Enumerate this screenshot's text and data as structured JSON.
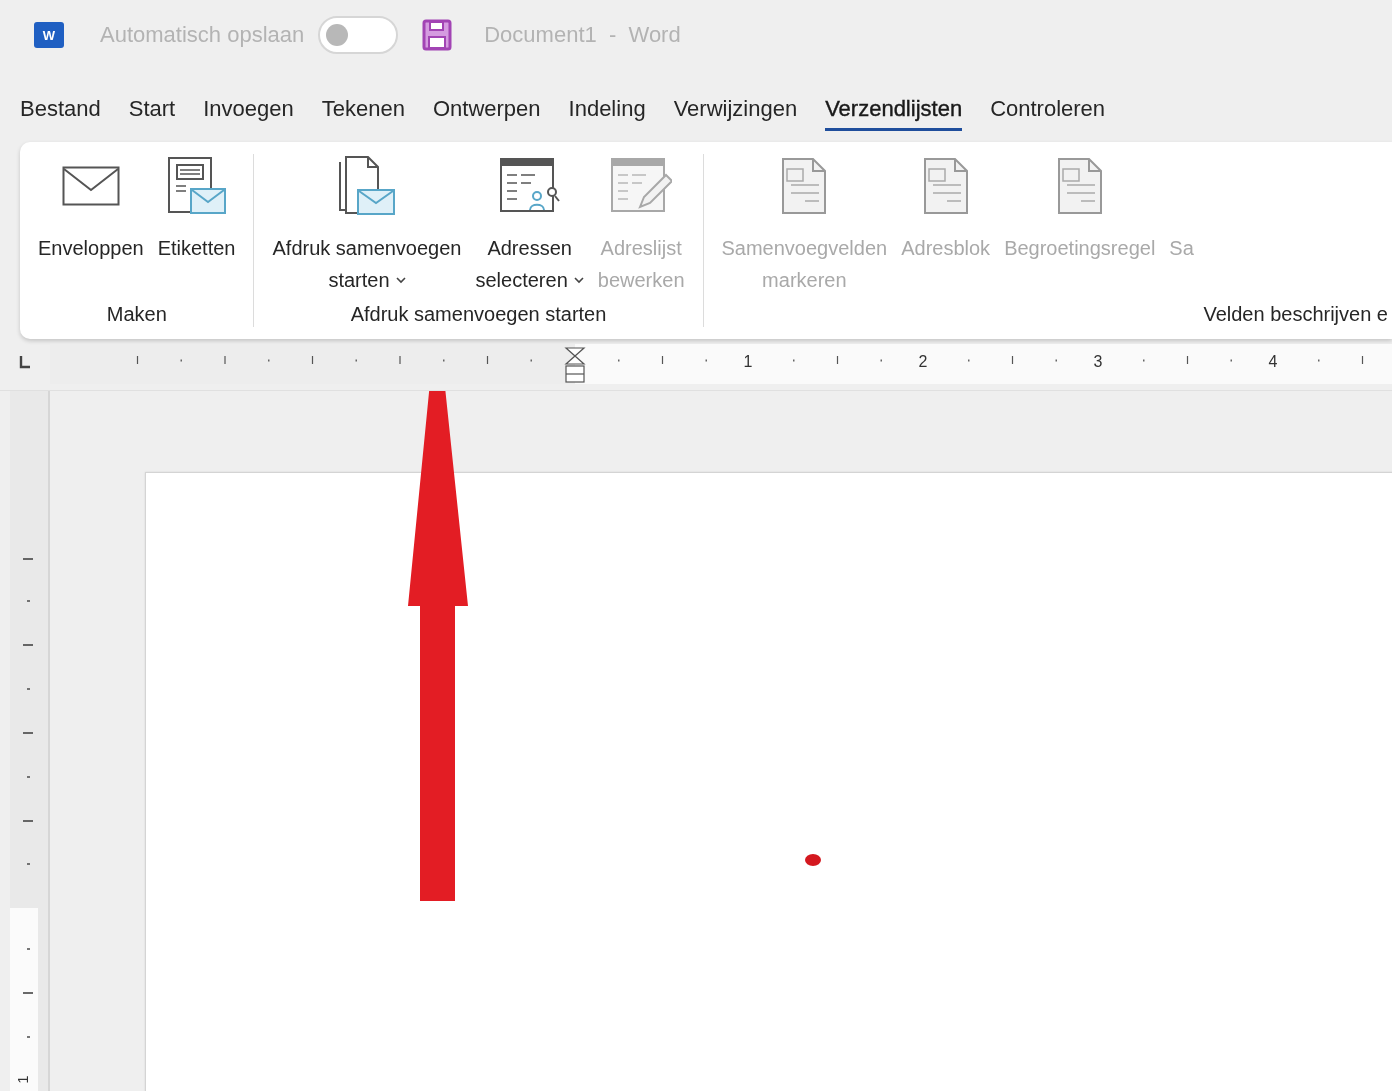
{
  "title_bar": {
    "app_icon_letter": "W",
    "autosave_label": "Automatisch opslaan",
    "autosave_on": false,
    "document_title": "Document1  -  Word"
  },
  "tabs": [
    {
      "label": "Bestand",
      "selected": false
    },
    {
      "label": "Start",
      "selected": false
    },
    {
      "label": "Invoegen",
      "selected": false
    },
    {
      "label": "Tekenen",
      "selected": false
    },
    {
      "label": "Ontwerpen",
      "selected": false
    },
    {
      "label": "Indeling",
      "selected": false
    },
    {
      "label": "Verwijzingen",
      "selected": false
    },
    {
      "label": "Verzendlijsten",
      "selected": true
    },
    {
      "label": "Controleren",
      "selected": false
    }
  ],
  "ribbon": {
    "groups": [
      {
        "label": "Maken",
        "buttons": [
          {
            "kind": "envelope",
            "lines": [
              "Enveloppen"
            ],
            "disabled": false,
            "dropdown": false
          },
          {
            "kind": "labels",
            "lines": [
              "Etiketten"
            ],
            "disabled": false,
            "dropdown": false
          }
        ]
      },
      {
        "label": "Afdruk samenvoegen starten",
        "buttons": [
          {
            "kind": "merge",
            "lines": [
              "Afdruk samenvoegen",
              "starten"
            ],
            "disabled": false,
            "dropdown": true
          },
          {
            "kind": "recipients",
            "lines": [
              "Adressen",
              "selecteren"
            ],
            "disabled": false,
            "dropdown": true
          },
          {
            "kind": "editlist",
            "lines": [
              "Adreslijst",
              "bewerken"
            ],
            "disabled": true,
            "dropdown": false
          }
        ]
      },
      {
        "label": "Velden beschrijven e",
        "buttons": [
          {
            "kind": "field",
            "lines": [
              "Samenvoegvelden",
              "markeren"
            ],
            "disabled": true,
            "dropdown": false
          },
          {
            "kind": "field",
            "lines": [
              "Adresblok"
            ],
            "disabled": true,
            "dropdown": false
          },
          {
            "kind": "field",
            "lines": [
              "Begroetingsregel"
            ],
            "disabled": true,
            "dropdown": false
          },
          {
            "kind": "text",
            "lines": [
              "Sa"
            ],
            "disabled": true,
            "dropdown": false
          }
        ]
      }
    ]
  },
  "ruler": {
    "numbers": [
      "1",
      "2",
      "3",
      "4"
    ]
  },
  "vertical_ruler": {
    "numbers": [
      "1"
    ]
  },
  "annotations": [
    {
      "kind": "arrow"
    },
    {
      "kind": "dot"
    }
  ]
}
